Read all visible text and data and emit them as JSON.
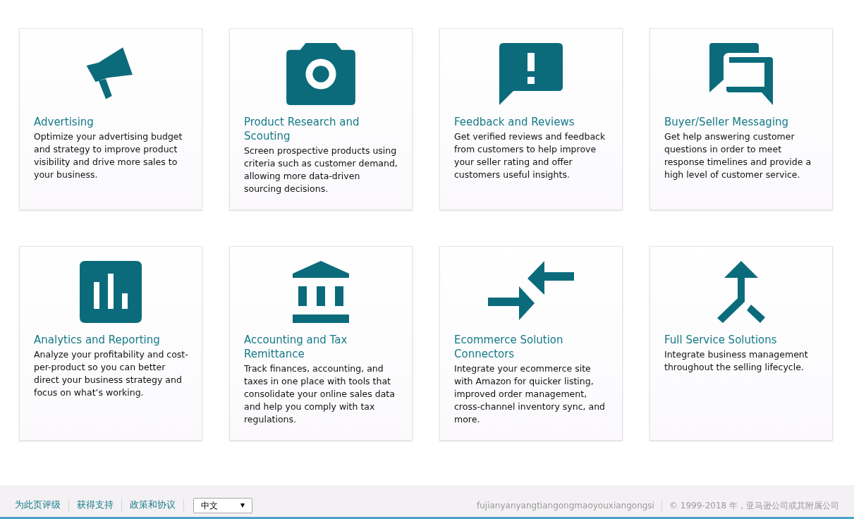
{
  "cards": [
    {
      "kind": "megaphone",
      "title": "Advertising",
      "text": "Optimize your advertising budget and strategy to improve product visibility and drive more sales to your business."
    },
    {
      "kind": "camera",
      "title": "Product Research and Scouting",
      "text": "Screen prospective products using criteria such as customer demand, allowing more data-driven sourcing decisions."
    },
    {
      "kind": "alert-bubble",
      "title": "Feedback and Reviews",
      "text": "Get verified reviews and feedback from customers to help improve your seller rating and offer customers useful insights."
    },
    {
      "kind": "chat-bubbles",
      "title": "Buyer/Seller Messaging",
      "text": "Get help answering customer questions in order to meet response timelines and provide a high level of customer service."
    },
    {
      "kind": "bar-chart",
      "title": "Analytics and Reporting",
      "text": "Analyze your profitability and cost-per-product so you can better direct your business strategy and focus on what’s working."
    },
    {
      "kind": "bank",
      "title": "Accounting and Tax Remittance",
      "text": "Track finances, accounting, and taxes in one place with tools that consolidate your online sales data and help you comply with tax regulations."
    },
    {
      "kind": "arrows",
      "title": "Ecommerce Solution Connectors",
      "text": "Integrate your ecommerce site with Amazon for quicker listing, improved order management, cross-channel inventory sync, and more."
    },
    {
      "kind": "merge",
      "title": "Full Service Solutions",
      "text": "Integrate business management throughout the selling lifecycle."
    }
  ],
  "footer": {
    "links": [
      "为此页评级",
      "获得支持",
      "政策和协议"
    ],
    "language": "中文",
    "company": "fujianyanyangtiangongmaoyouxiangongsi",
    "copyright": "© 1999-2018 年，亚马逊公司或其附属公司"
  }
}
